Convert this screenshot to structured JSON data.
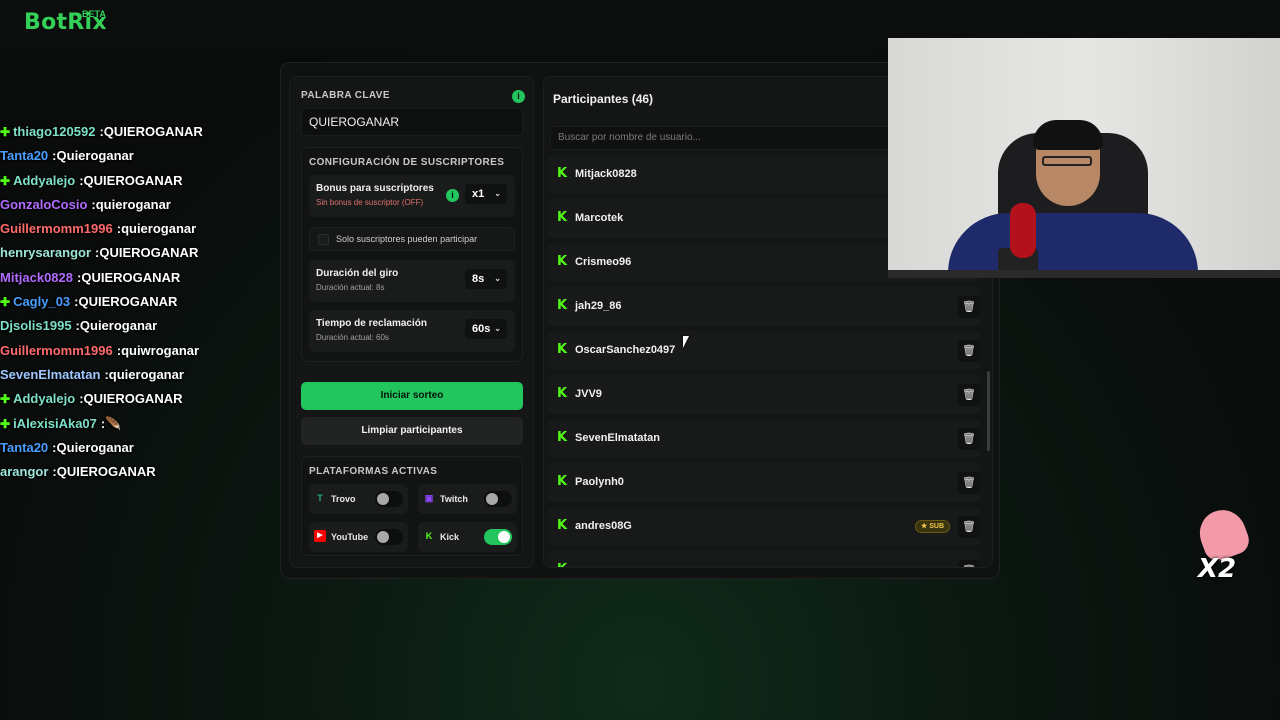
{
  "app": {
    "logo": "BotRix",
    "beta_label": "BETA"
  },
  "chat": [
    {
      "user": "thiago120592",
      "text": "QUIEROGANAR",
      "color": "#7ee0c8",
      "badge": true
    },
    {
      "user": "Tanta20",
      "text": "Quieroganar",
      "color": "#4a9eff",
      "badge": false
    },
    {
      "user": "Addyalejo",
      "text": "QUIEROGANAR",
      "color": "#7ee0c8",
      "badge": true
    },
    {
      "user": "GonzaloCosio",
      "text": "quieroganar",
      "color": "#b26bff",
      "badge": false
    },
    {
      "user": "Guillermomm1996",
      "text": "quieroganar",
      "color": "#ff6b6b",
      "badge": false
    },
    {
      "user": "henrysarangor",
      "text": "QUIEROGANAR",
      "color": "#9ee6d8",
      "badge": false
    },
    {
      "user": "Mitjack0828",
      "text": "QUIEROGANAR",
      "color": "#b26bff",
      "badge": false
    },
    {
      "user": "Cagly_03",
      "text": "QUIEROGANAR",
      "color": "#4a9eff",
      "badge": true
    },
    {
      "user": "Djsolis1995",
      "text": "Quieroganar",
      "color": "#7ee0c8",
      "badge": false
    },
    {
      "user": "Guillermomm1996",
      "text": "quiwroganar",
      "color": "#ff6b6b",
      "badge": false
    },
    {
      "user": "SevenElmatatan",
      "text": "quieroganar",
      "color": "#9ec8ff",
      "badge": false
    },
    {
      "user": "Addyalejo",
      "text": "QUIEROGANAR",
      "color": "#7ee0c8",
      "badge": true
    },
    {
      "user": "iAlexisiAka07",
      "text": "🪶",
      "color": "#7ee0c8",
      "badge": true
    },
    {
      "user": "Tanta20",
      "text": "Quieroganar",
      "color": "#4a9eff",
      "badge": false
    },
    {
      "user": "arangor",
      "text": "QUIEROGANAR",
      "color": "#9ee6d8",
      "badge": false
    }
  ],
  "keyword": {
    "title": "PALABRA CLAVE",
    "info": "i",
    "value": "QUIEROGANAR"
  },
  "subscribers": {
    "title": "CONFIGURACIÓN DE SUSCRIPTORES",
    "bonus_label": "Bonus para suscriptores",
    "bonus_sub": "Sin bonus de suscriptor (OFF)",
    "bonus_value": "x1",
    "only_subs_label": "Solo suscriptores pueden participar",
    "spin_label": "Duración del giro",
    "spin_sub": "Duración actual: 8s",
    "spin_value": "8s",
    "claim_label": "Tiempo de reclamación",
    "claim_sub": "Duración actual: 60s",
    "claim_value": "60s"
  },
  "actions": {
    "start": "Iniciar sorteo",
    "clear": "Limpiar participantes"
  },
  "platforms": {
    "title": "PLATAFORMAS ACTIVAS",
    "items": [
      {
        "name": "Trovo",
        "enabled": false,
        "icon": "trovo-icon",
        "color": "#1bb57e"
      },
      {
        "name": "Twitch",
        "enabled": false,
        "icon": "twitch-icon",
        "color": "#9146ff"
      },
      {
        "name": "YouTube",
        "enabled": false,
        "icon": "youtube-icon",
        "color": "#ff0000"
      },
      {
        "name": "Kick",
        "enabled": true,
        "icon": "kick-icon",
        "color": "#53fc18"
      }
    ]
  },
  "participants": {
    "title": "Participantes (46)",
    "search_placeholder": "Buscar por nombre de usuario...",
    "rows": [
      {
        "name": "Mitjack0828",
        "sub": false
      },
      {
        "name": "Marcotek",
        "sub": false
      },
      {
        "name": "Crismeo96",
        "sub": false
      },
      {
        "name": "jah29_86",
        "sub": false
      },
      {
        "name": "OscarSanchez0497",
        "sub": false
      },
      {
        "name": "JVV9",
        "sub": false
      },
      {
        "name": "SevenElmatatan",
        "sub": false
      },
      {
        "name": "Paolynh0",
        "sub": false
      },
      {
        "name": "andres08G",
        "sub": true
      },
      {
        "name": "",
        "sub": false
      }
    ],
    "sub_badge": "★ SUB"
  },
  "overlay": {
    "emote_multiplier": "X2"
  },
  "colors": {
    "accent": "#22c55e",
    "kick": "#53fc18"
  }
}
